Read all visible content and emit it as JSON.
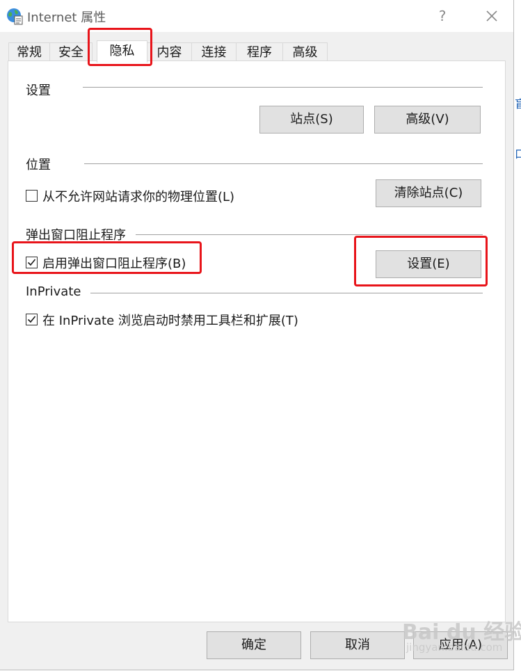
{
  "window": {
    "title": "Internet 属性",
    "help_glyph": "?"
  },
  "tabs": [
    {
      "label": "常规"
    },
    {
      "label": "安全"
    },
    {
      "label": "隐私",
      "active": true
    },
    {
      "label": "内容"
    },
    {
      "label": "连接"
    },
    {
      "label": "程序"
    },
    {
      "label": "高级"
    }
  ],
  "settings_section": {
    "title": "设置",
    "sites_button": "站点(S)",
    "advanced_button": "高级(V)"
  },
  "location_section": {
    "title": "位置",
    "never_allow_label": "从不允许网站请求你的物理位置(L)",
    "never_allow_checked": false,
    "clear_sites_button": "清除站点(C)"
  },
  "popup_section": {
    "title": "弹出窗口阻止程序",
    "enable_label": "启用弹出窗口阻止程序(B)",
    "enable_checked": true,
    "settings_button": "设置(E)"
  },
  "inprivate_section": {
    "title": "InPrivate",
    "disable_label": "在 InPrivate 浏览启动时禁用工具栏和扩展(T)",
    "disable_checked": true
  },
  "footer": {
    "ok_button": "确定",
    "cancel_button": "取消",
    "apply_button": "应用(A)"
  },
  "watermark": {
    "main": "Bai du 经验",
    "sub": "jingyan.baidu.com"
  },
  "colors": {
    "annotation": "#e8141a",
    "button_bg": "#e1e1e1",
    "dialog_bg": "#f0f0f0"
  }
}
